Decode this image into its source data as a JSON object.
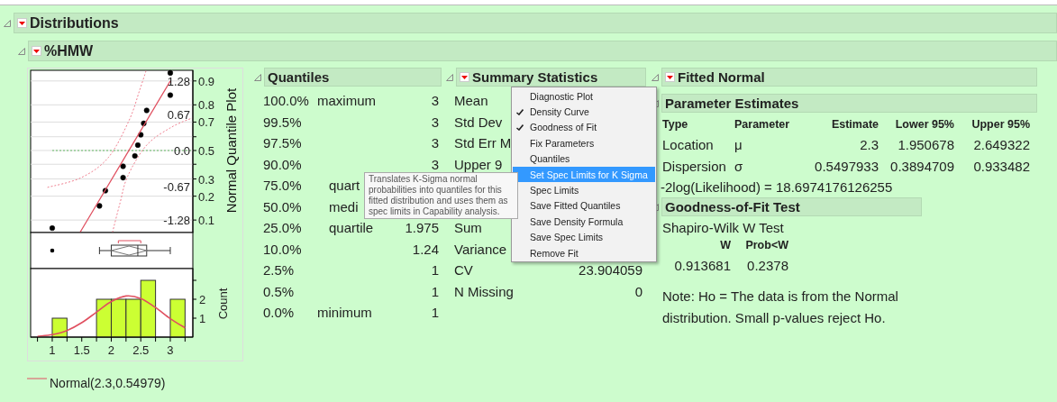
{
  "report": {
    "title": "Distributions",
    "expanded": true
  },
  "variable": {
    "title": "%HMW",
    "expanded": true
  },
  "plots": {
    "quantile_plot": {
      "chart_data": {
        "type": "scatter",
        "ylabel": "Normal Quantile Plot",
        "x": [
          1,
          1.8,
          1.9,
          2.2,
          2.2,
          2.4,
          2.45,
          2.5,
          2.55,
          2.6,
          3,
          3
        ],
        "series": [
          {
            "type": "scatter",
            "color": "#000000",
            "values": [
              -1.43,
              -1.02,
              -0.74,
              -0.5,
              -0.29,
              -0.1,
              0.1,
              0.29,
              0.5,
              0.74,
              1.02,
              1.43
            ]
          },
          {
            "type": "line",
            "color": "#e05060",
            "x": [
              1.47,
              3.0
            ],
            "values": [
              -1.51,
              1.28
            ]
          },
          {
            "type": "line",
            "line_style": "dotted",
            "color": "#f08090",
            "x": [
              0.92,
              1.49,
              1.95,
              2.3,
              2.48,
              2.59
            ],
            "values": [
              -0.68,
              -0.5,
              -0.13,
              0.55,
              1.11,
              1.47
            ]
          },
          {
            "type": "line",
            "line_style": "dotted",
            "color": "#f08090",
            "x": [
              2.02,
              2.15,
              2.28,
              2.6,
              3.02,
              3.37
            ],
            "values": [
              -1.51,
              -0.96,
              -0.47,
              0.1,
              0.43,
              0.6
            ]
          }
        ],
        "ref_lines": [
          {
            "axis": "y",
            "value": 0,
            "color": "#66bb66"
          }
        ],
        "grid": true,
        "xlim": [
          0.634,
          3.382
        ],
        "ylim": [
          -1.512,
          1.478
        ],
        "yticks": [
          {
            "value": 1.28,
            "label": "1.28"
          },
          {
            "value": 0.67,
            "label": "0.67"
          },
          {
            "value": 0,
            "label": "0.0"
          },
          {
            "value": -0.67,
            "label": "-0.67"
          },
          {
            "value": -1.28,
            "label": "-1.28"
          }
        ]
      },
      "probability_axis": {
        "labels": [
          "0.9",
          "0.8",
          "0.7",
          "0.5",
          "0.3",
          "0.2",
          "0.1"
        ]
      }
    },
    "histogram": {
      "chart_data": {
        "type": "bar",
        "ylabel": "Count",
        "x": [
          1.125,
          1.375,
          1.625,
          1.875,
          2.125,
          2.375,
          2.625,
          2.875,
          3.125
        ],
        "series": [
          {
            "type": "bar",
            "color": "#ccff33",
            "values": [
              1,
              0,
              0,
              2,
              2,
              2,
              3,
              0,
              2
            ]
          },
          {
            "type": "line",
            "name": "Normal(2.3,0.54979)",
            "color": "#e05060",
            "x": [
              0.75,
              1,
              1.25,
              1.5,
              1.75,
              2,
              2.25,
              2.5,
              2.75,
              3,
              3.25
            ],
            "values": [
              0.04,
              0.13,
              0.35,
              0.76,
              1.32,
              1.88,
              2.17,
              2.04,
              1.56,
              0.97,
              0.49
            ]
          }
        ],
        "xlim": [
          0.634,
          3.382
        ],
        "ylim": [
          0,
          3.62
        ],
        "xticks": [
          1,
          1.5,
          2,
          2.5,
          3
        ],
        "yticks": [
          1,
          2
        ]
      }
    }
  },
  "quantiles": {
    "title": "Quantiles",
    "expanded": true,
    "rows": [
      {
        "percent": "100.0%",
        "label": "maximum",
        "value": "3"
      },
      {
        "percent": "99.5%",
        "value": "3"
      },
      {
        "percent": "97.5%",
        "value": "3"
      },
      {
        "percent": "90.0%",
        "value": "3"
      },
      {
        "percent": "75.0%",
        "label": "quart"
      },
      {
        "percent": "50.0%",
        "label": "medi"
      },
      {
        "percent": "25.0%",
        "label": "quartile",
        "value": "1.975"
      },
      {
        "percent": "10.0%",
        "value": "1.24"
      },
      {
        "percent": "2.5%",
        "value": "1"
      },
      {
        "percent": "0.5%",
        "value": "1"
      },
      {
        "percent": "0.0%",
        "label": "minimum",
        "value": "1"
      }
    ]
  },
  "summary_statistics": {
    "title": "Summary Statistics",
    "expanded": true,
    "rows_top": [
      {
        "label": "Mean"
      },
      {
        "label": "Std Dev"
      },
      {
        "label": "Std Err M"
      },
      {
        "label": "Upper 9"
      }
    ],
    "rows_bottom": [
      {
        "label": "Sum"
      },
      {
        "label": "Variance"
      },
      {
        "label": "CV",
        "value": "23.904059"
      },
      {
        "label": "N Missing",
        "value": "0"
      }
    ]
  },
  "fitted_normal": {
    "title": "Fitted Normal",
    "expanded": true,
    "parameter_estimates": {
      "title": "Parameter Estimates",
      "expanded": true,
      "columns": [
        "Type",
        "Parameter",
        "Estimate",
        "Lower 95%",
        "Upper 95%"
      ],
      "rows": [
        [
          "Location",
          "μ",
          "2.3",
          "1.950678",
          "2.649322"
        ],
        [
          "Dispersion",
          "σ",
          "0.5497933",
          "0.3894709",
          "0.933482"
        ]
      ],
      "likelihood": "-2log(Likelihood) = 18.6974176126255"
    },
    "goodness_of_fit": {
      "title": "Goodness-of-Fit Test",
      "expanded": true,
      "test_name": "Shapiro-Wilk W Test",
      "columns": [
        "W",
        "Prob<W"
      ],
      "values": [
        "0.913681",
        "0.2378"
      ],
      "note": "Note: Ho = The data is from the Normal distribution. Small p-values reject Ho."
    }
  },
  "context_menu": {
    "items": [
      {
        "label": "Diagnostic Plot",
        "checked": false,
        "selected": false
      },
      {
        "label": "Density Curve",
        "checked": true,
        "selected": false
      },
      {
        "label": "Goodness of Fit",
        "checked": true,
        "selected": false
      },
      {
        "label": "Fix Parameters",
        "checked": false,
        "selected": false
      },
      {
        "label": "Quantiles",
        "checked": false,
        "selected": false
      },
      {
        "label": "Set Spec Limits for K Sigma",
        "checked": false,
        "selected": true
      },
      {
        "label": "Spec Limits",
        "checked": false,
        "selected": false
      },
      {
        "label": "Save Fitted Quantiles",
        "checked": false,
        "selected": false
      },
      {
        "label": "Save Density Formula",
        "checked": false,
        "selected": false
      },
      {
        "label": "Save Spec Limits",
        "checked": false,
        "selected": false
      },
      {
        "label": "Remove Fit",
        "checked": false,
        "selected": false
      }
    ]
  },
  "tooltip": {
    "text": "Translates K-Sigma normal probabilities into quantiles for this fitted distribution and uses them as spec limits in Capability analysis."
  }
}
